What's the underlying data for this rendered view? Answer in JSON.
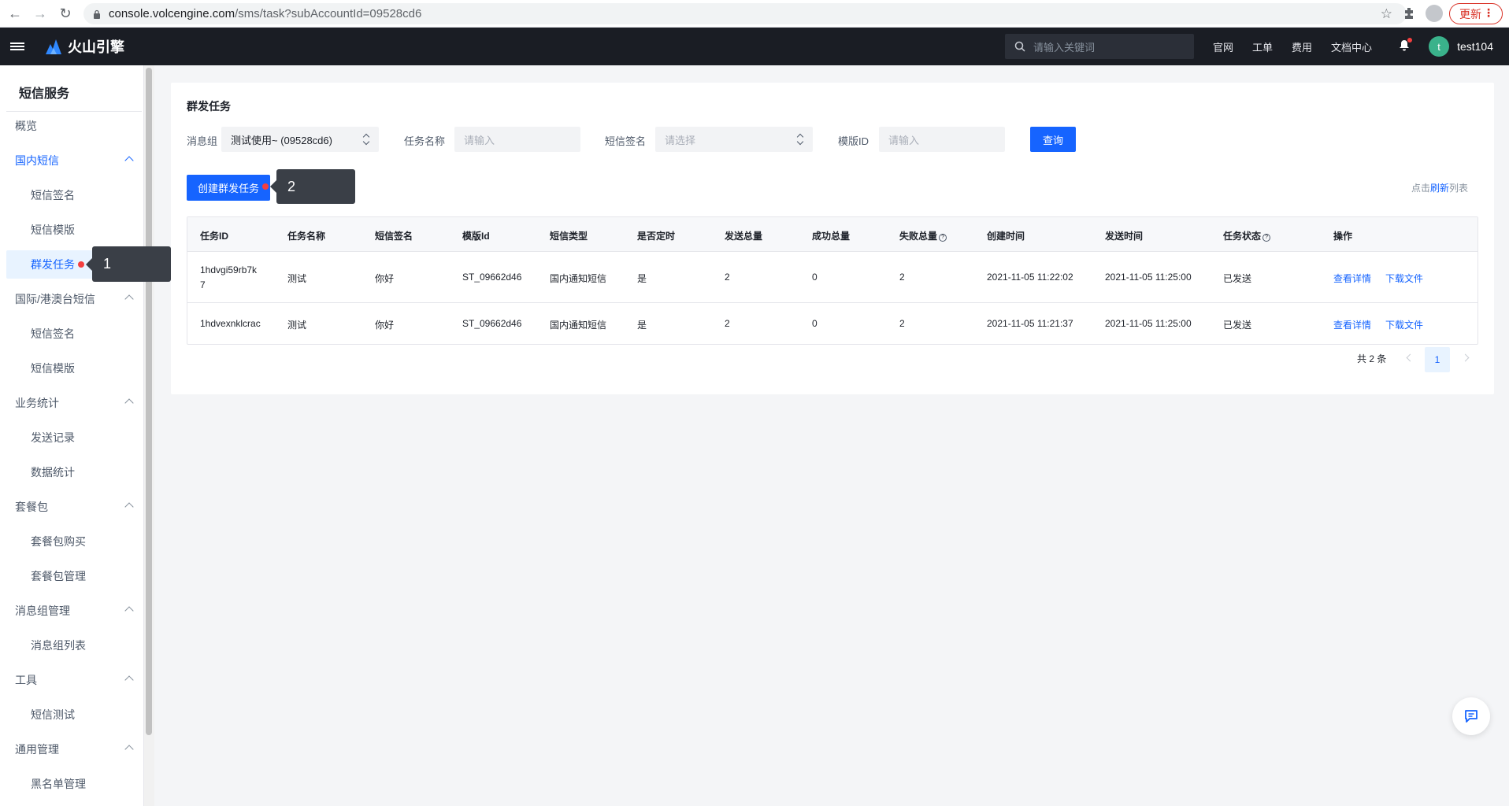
{
  "browser": {
    "url_host": "console.volcengine.com",
    "url_path": "/sms/task?subAccountId=09528cd6",
    "update_label": "更新"
  },
  "topnav": {
    "brand": "火山引擎",
    "search_placeholder": "请输入关键词",
    "links": [
      "官网",
      "工单",
      "费用",
      "文档中心"
    ],
    "avatar_letter": "t",
    "username": "test104"
  },
  "sidebar": {
    "title": "短信服务",
    "items": [
      {
        "label": "概览",
        "level": 1
      },
      {
        "label": "国内短信",
        "level": 1,
        "group": true,
        "open": true
      },
      {
        "label": "短信签名",
        "level": 2
      },
      {
        "label": "短信模版",
        "level": 2
      },
      {
        "label": "群发任务",
        "level": 2,
        "active": true
      },
      {
        "label": "国际/港澳台短信",
        "level": 1,
        "group": true
      },
      {
        "label": "短信签名",
        "level": 2
      },
      {
        "label": "短信模版",
        "level": 2
      },
      {
        "label": "业务统计",
        "level": 1,
        "group": true
      },
      {
        "label": "发送记录",
        "level": 2
      },
      {
        "label": "数据统计",
        "level": 2
      },
      {
        "label": "套餐包",
        "level": 1,
        "group": true
      },
      {
        "label": "套餐包购买",
        "level": 2
      },
      {
        "label": "套餐包管理",
        "level": 2
      },
      {
        "label": "消息组管理",
        "level": 1,
        "group": true
      },
      {
        "label": "消息组列表",
        "level": 2
      },
      {
        "label": "工具",
        "level": 1,
        "group": true
      },
      {
        "label": "短信测试",
        "level": 2
      },
      {
        "label": "通用管理",
        "level": 1,
        "group": true
      },
      {
        "label": "黑名单管理",
        "level": 2
      }
    ]
  },
  "annotations": {
    "step1": "1",
    "step2": "2"
  },
  "page": {
    "title": "群发任务",
    "filters": {
      "message_group_label": "消息组",
      "message_group_value": "测试使用~ (09528cd6)",
      "task_name_label": "任务名称",
      "task_name_placeholder": "请输入",
      "signature_label": "短信签名",
      "signature_placeholder": "请选择",
      "template_id_label": "模版ID",
      "template_id_placeholder": "请输入",
      "query_label": "查询"
    },
    "create_label": "创建群发任务",
    "refresh_prefix": "点击",
    "refresh_link": "刷新",
    "refresh_suffix": "列表"
  },
  "table": {
    "columns": [
      "任务ID",
      "任务名称",
      "短信签名",
      "模版Id",
      "短信类型",
      "是否定时",
      "发送总量",
      "成功总量",
      "失败总量",
      "创建时间",
      "发送时间",
      "任务状态",
      "操作"
    ],
    "help_icon": "?",
    "rows": [
      {
        "id_line1": "1hdvgi59rb7k",
        "id_line2": "7",
        "name": "测试",
        "signature": "你好",
        "template": "ST_09662d46",
        "type": "国内通知短信",
        "scheduled": "是",
        "total": "2",
        "success": "0",
        "failed": "2",
        "created": "2021-11-05 11:22:02",
        "sent": "2021-11-05 11:25:00",
        "status": "已发送",
        "action_detail": "查看详情",
        "action_download": "下载文件"
      },
      {
        "id_line1": "1hdvexnklcrac",
        "id_line2": "",
        "name": "测试",
        "signature": "你好",
        "template": "ST_09662d46",
        "type": "国内通知短信",
        "scheduled": "是",
        "total": "2",
        "success": "0",
        "failed": "2",
        "created": "2021-11-05 11:21:37",
        "sent": "2021-11-05 11:25:00",
        "status": "已发送",
        "action_detail": "查看详情",
        "action_download": "下载文件"
      }
    ]
  },
  "pagination": {
    "total_text": "共 2 条",
    "current_page": "1"
  }
}
